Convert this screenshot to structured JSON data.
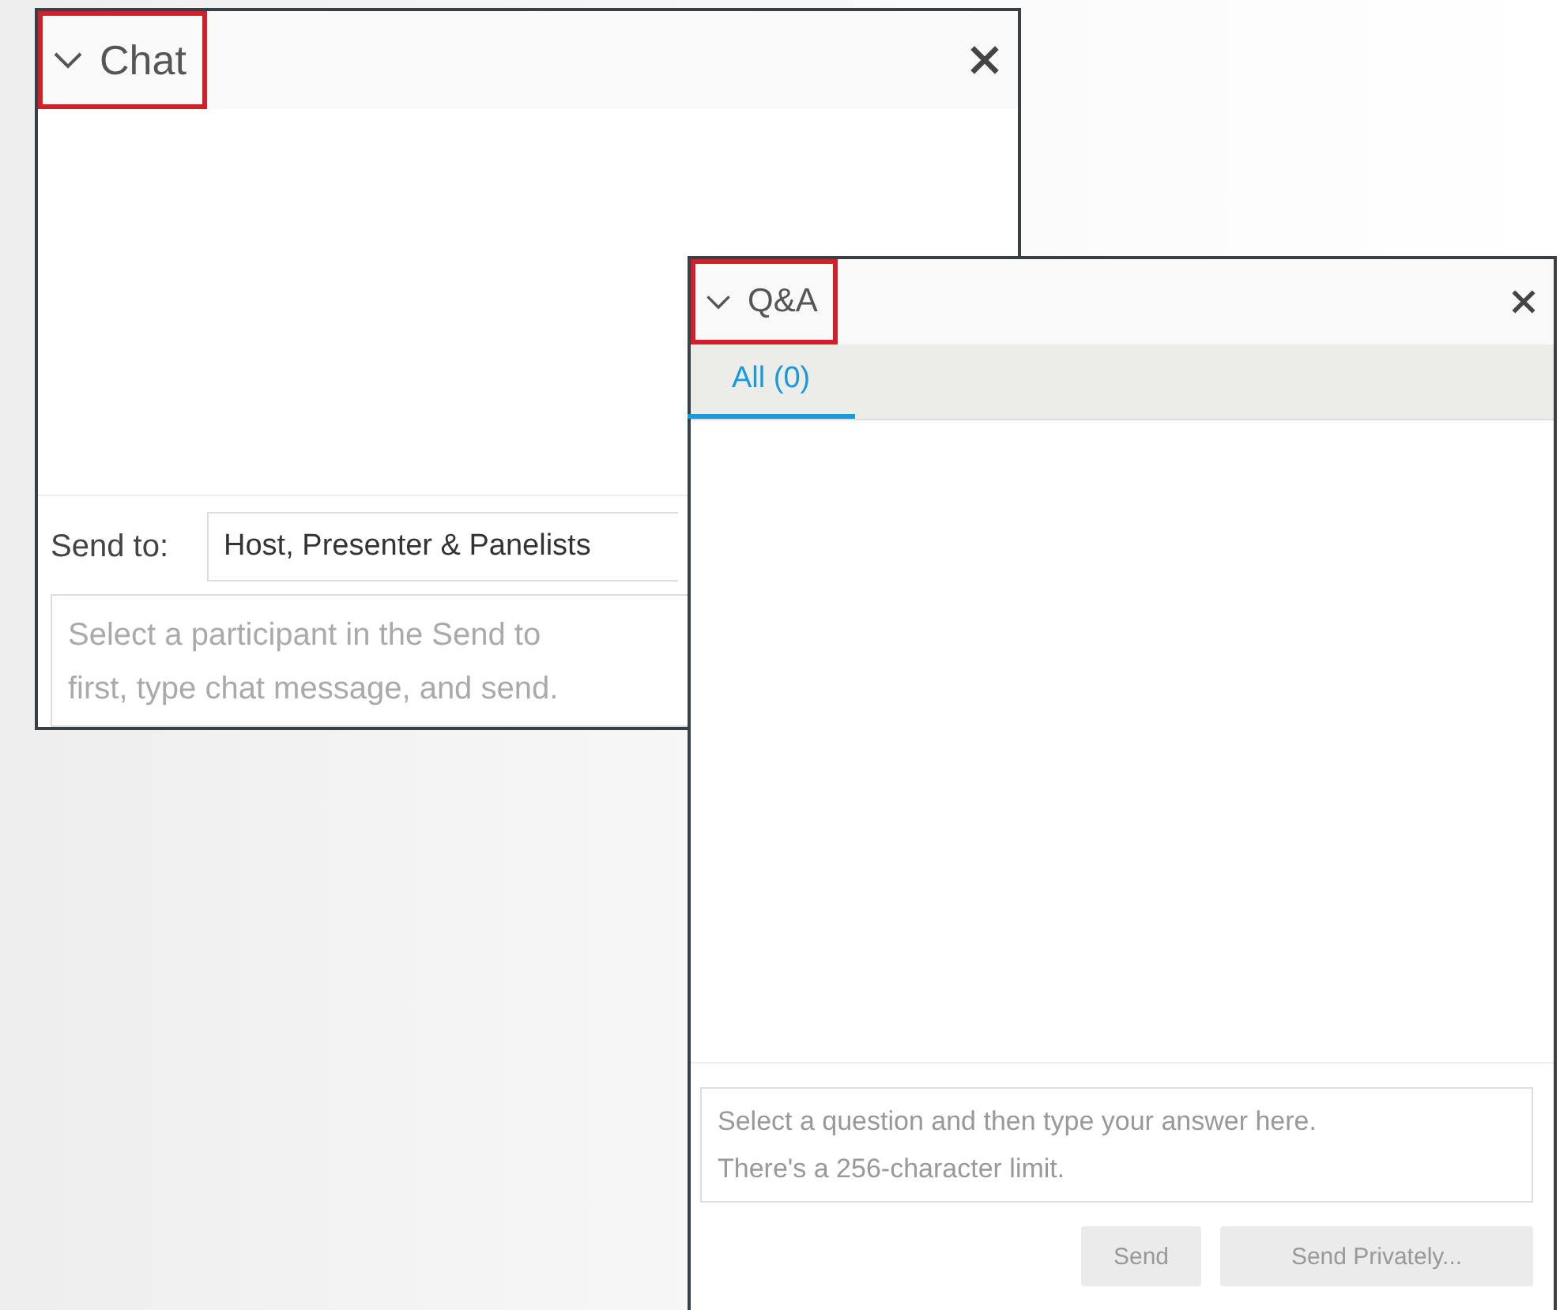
{
  "chat_panel": {
    "title": "Chat",
    "expanded": true,
    "highlighted": true,
    "send_to_label": "Send to:",
    "send_to_value": "Host, Presenter & Panelists",
    "message_placeholder_lines": [
      "Select a participant in the Send to",
      "first, type chat message, and send."
    ]
  },
  "qa_panel": {
    "title": "Q&A",
    "expanded": true,
    "highlighted": true,
    "tabs": [
      {
        "label": "All (0)",
        "selected": true
      }
    ],
    "answer_placeholder_lines": [
      "Select a question and then type your answer here.",
      "There's a 256-character limit."
    ],
    "buttons": [
      {
        "label": "Send",
        "disabled": true
      },
      {
        "label": "Send Privately...",
        "disabled": true
      }
    ]
  }
}
